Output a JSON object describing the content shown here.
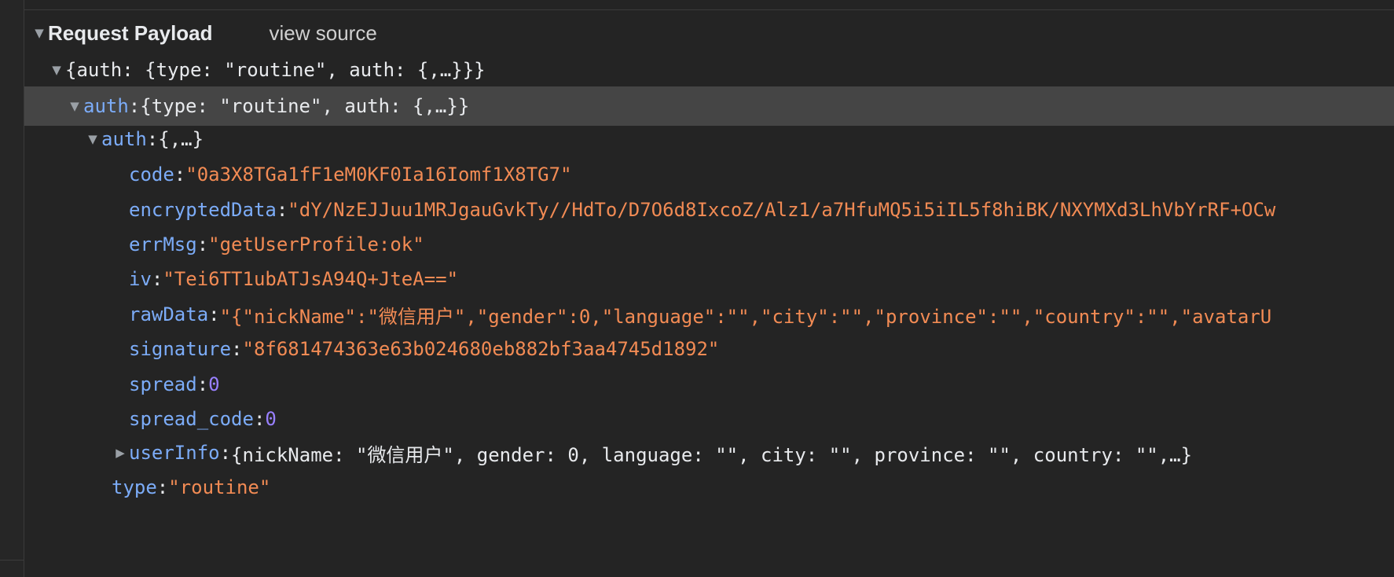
{
  "section": {
    "title": "Request Payload",
    "view_source": "view source"
  },
  "tree": {
    "root_summary": "{auth: {type: \"routine\", auth: {,…}}}",
    "auth_key": "auth",
    "auth_summary": "{type: \"routine\", auth: {,…}}",
    "inner_auth_key": "auth",
    "inner_auth_summary": "{,…}",
    "fields": [
      {
        "key": "code",
        "value": "\"0a3X8TGa1fF1eM0KF0Ia16Iomf1X8TG7\"",
        "kind": "string"
      },
      {
        "key": "encryptedData",
        "value": "\"dY/NzEJJuu1MRJgauGvkTy//HdTo/D7O6d8IxcoZ/Alz1/a7HfuMQ5i5iIL5f8hiBK/NXYMXd3LhVbYrRF+OCw",
        "kind": "string"
      },
      {
        "key": "errMsg",
        "value": "\"getUserProfile:ok\"",
        "kind": "string"
      },
      {
        "key": "iv",
        "value": "\"Tei6TT1ubATJsA94Q+JteA==\"",
        "kind": "string"
      },
      {
        "key": "rawData",
        "value": "\"{\"nickName\":\"微信用户\",\"gender\":0,\"language\":\"\",\"city\":\"\",\"province\":\"\",\"country\":\"\",\"avatarU",
        "kind": "string"
      },
      {
        "key": "signature",
        "value": "\"8f681474363e63b024680eb882bf3aa4745d1892\"",
        "kind": "string"
      },
      {
        "key": "spread",
        "value": "0",
        "kind": "number"
      },
      {
        "key": "spread_code",
        "value": "0",
        "kind": "number"
      }
    ],
    "userinfo_key": "userInfo",
    "userinfo_summary": "{nickName: \"微信用户\", gender: 0, language: \"\", city: \"\", province: \"\", country: \"\",…}",
    "type_key": "type",
    "type_value": "\"routine\""
  },
  "icons": {
    "expanded": "triangle-down",
    "collapsed": "triangle-right"
  },
  "colors": {
    "background": "#242424",
    "selected_row": "#454545",
    "key": "#7cacf8",
    "string": "#f28b54",
    "number": "#9980ff"
  }
}
